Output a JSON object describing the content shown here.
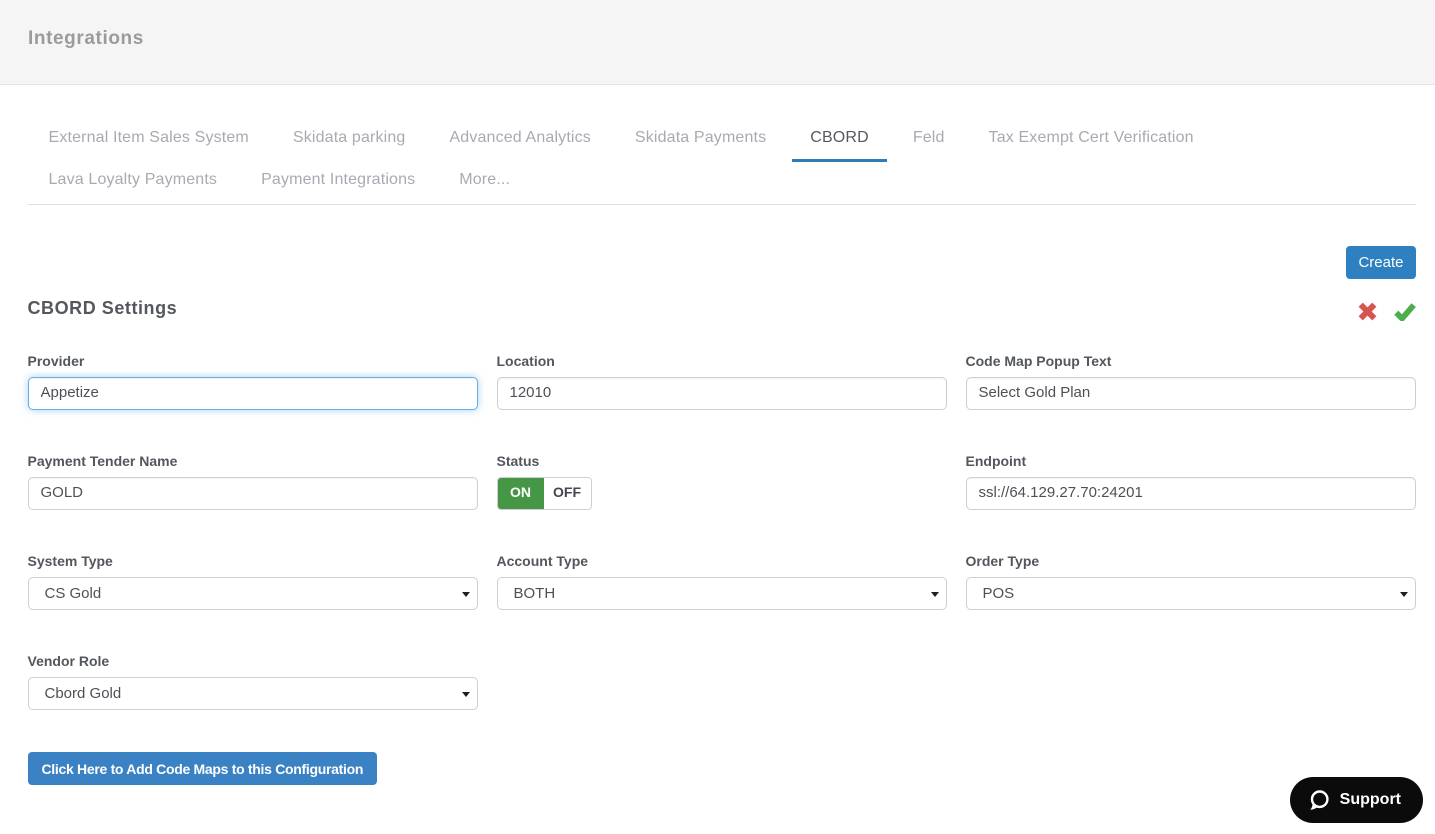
{
  "header": {
    "title": "Integrations"
  },
  "tabs": {
    "items": [
      {
        "label": "External Item Sales System",
        "active": false
      },
      {
        "label": "Skidata parking",
        "active": false
      },
      {
        "label": "Advanced Analytics",
        "active": false
      },
      {
        "label": "Skidata Payments",
        "active": false
      },
      {
        "label": "CBORD",
        "active": true
      },
      {
        "label": "Feld",
        "active": false
      },
      {
        "label": "Tax Exempt Cert Verification",
        "active": false
      },
      {
        "label": "Lava Loyalty Payments",
        "active": false
      },
      {
        "label": "Payment Integrations",
        "active": false
      },
      {
        "label": "More...",
        "active": false
      }
    ]
  },
  "toolbar": {
    "create_label": "Create"
  },
  "section": {
    "title": "CBORD Settings",
    "icons": {
      "cancel": "red-x-icon",
      "confirm": "green-check-icon"
    }
  },
  "form": {
    "fields": {
      "provider": {
        "label": "Provider",
        "value": "Appetize"
      },
      "location": {
        "label": "Location",
        "value": "12010"
      },
      "code_map_popup_text": {
        "label": "Code Map Popup Text",
        "value": "Select Gold Plan"
      },
      "payment_tender_name": {
        "label": "Payment Tender Name",
        "value": "GOLD"
      },
      "status": {
        "label": "Status",
        "value": "ON",
        "on_label": "ON",
        "off_label": "OFF"
      },
      "endpoint": {
        "label": "Endpoint",
        "value": "ssl://64.129.27.70:24201"
      },
      "system_type": {
        "label": "System Type",
        "value": "CS Gold"
      },
      "account_type": {
        "label": "Account Type",
        "value": "BOTH"
      },
      "order_type": {
        "label": "Order Type",
        "value": "POS"
      },
      "vendor_role": {
        "label": "Vendor Role",
        "value": "Cbord Gold"
      }
    },
    "add_code_maps_label": "Click Here to Add Code Maps to this Configuration"
  },
  "support": {
    "label": "Support"
  },
  "colors": {
    "accent_blue": "#2e80c1",
    "tab_underline": "#2e7cb7",
    "toggle_on_green": "#489b46",
    "cancel_red": "#d9534f",
    "confirm_green": "#4cae4c",
    "header_bg": "#f5f5f5",
    "support_bg": "#0b0b0b"
  }
}
